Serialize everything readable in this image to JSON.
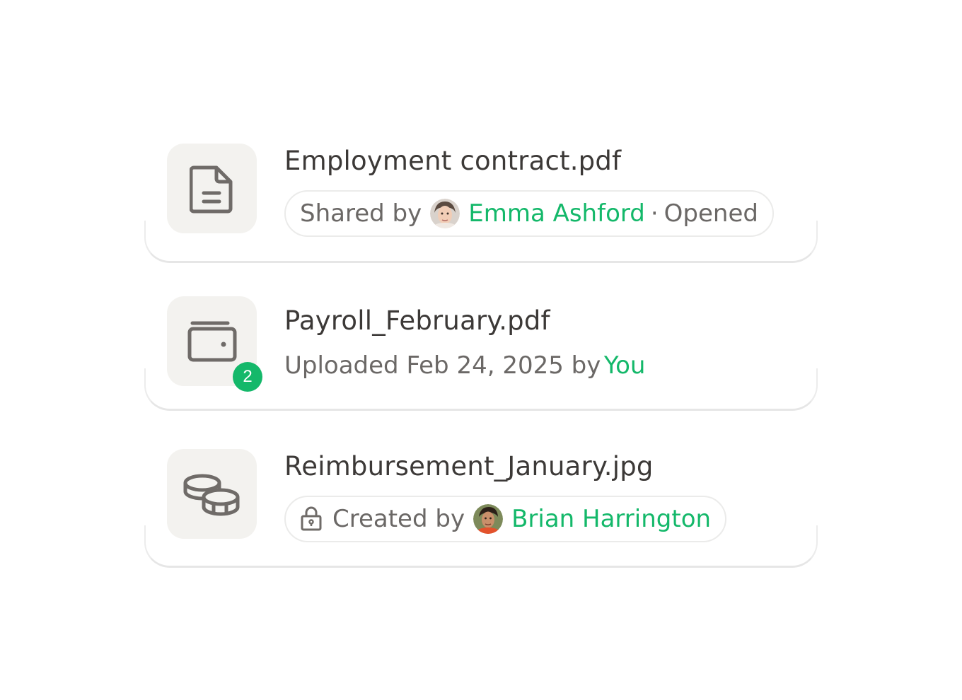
{
  "documents": [
    {
      "file_name": "Employment contract.pdf",
      "icon": "document-icon",
      "meta": {
        "prefix": "Shared by",
        "person": "Emma Ashford",
        "separator": "·",
        "status": "Opened"
      }
    },
    {
      "file_name": "Payroll_February.pdf",
      "icon": "wallet-icon",
      "badge_count": "2",
      "meta": {
        "prefix": "Uploaded Feb 24, 2025 by",
        "person": "You"
      }
    },
    {
      "file_name": "Reimbursement_January.jpg",
      "icon": "coins-icon",
      "meta": {
        "lock_icon": "lock-icon",
        "prefix": "Created by",
        "person": "Brian Harrington"
      }
    }
  ],
  "colors": {
    "accent": "#14b86a",
    "text_primary": "#3c3937",
    "text_secondary": "#6b6866",
    "tile_bg": "#f3f2ef"
  }
}
